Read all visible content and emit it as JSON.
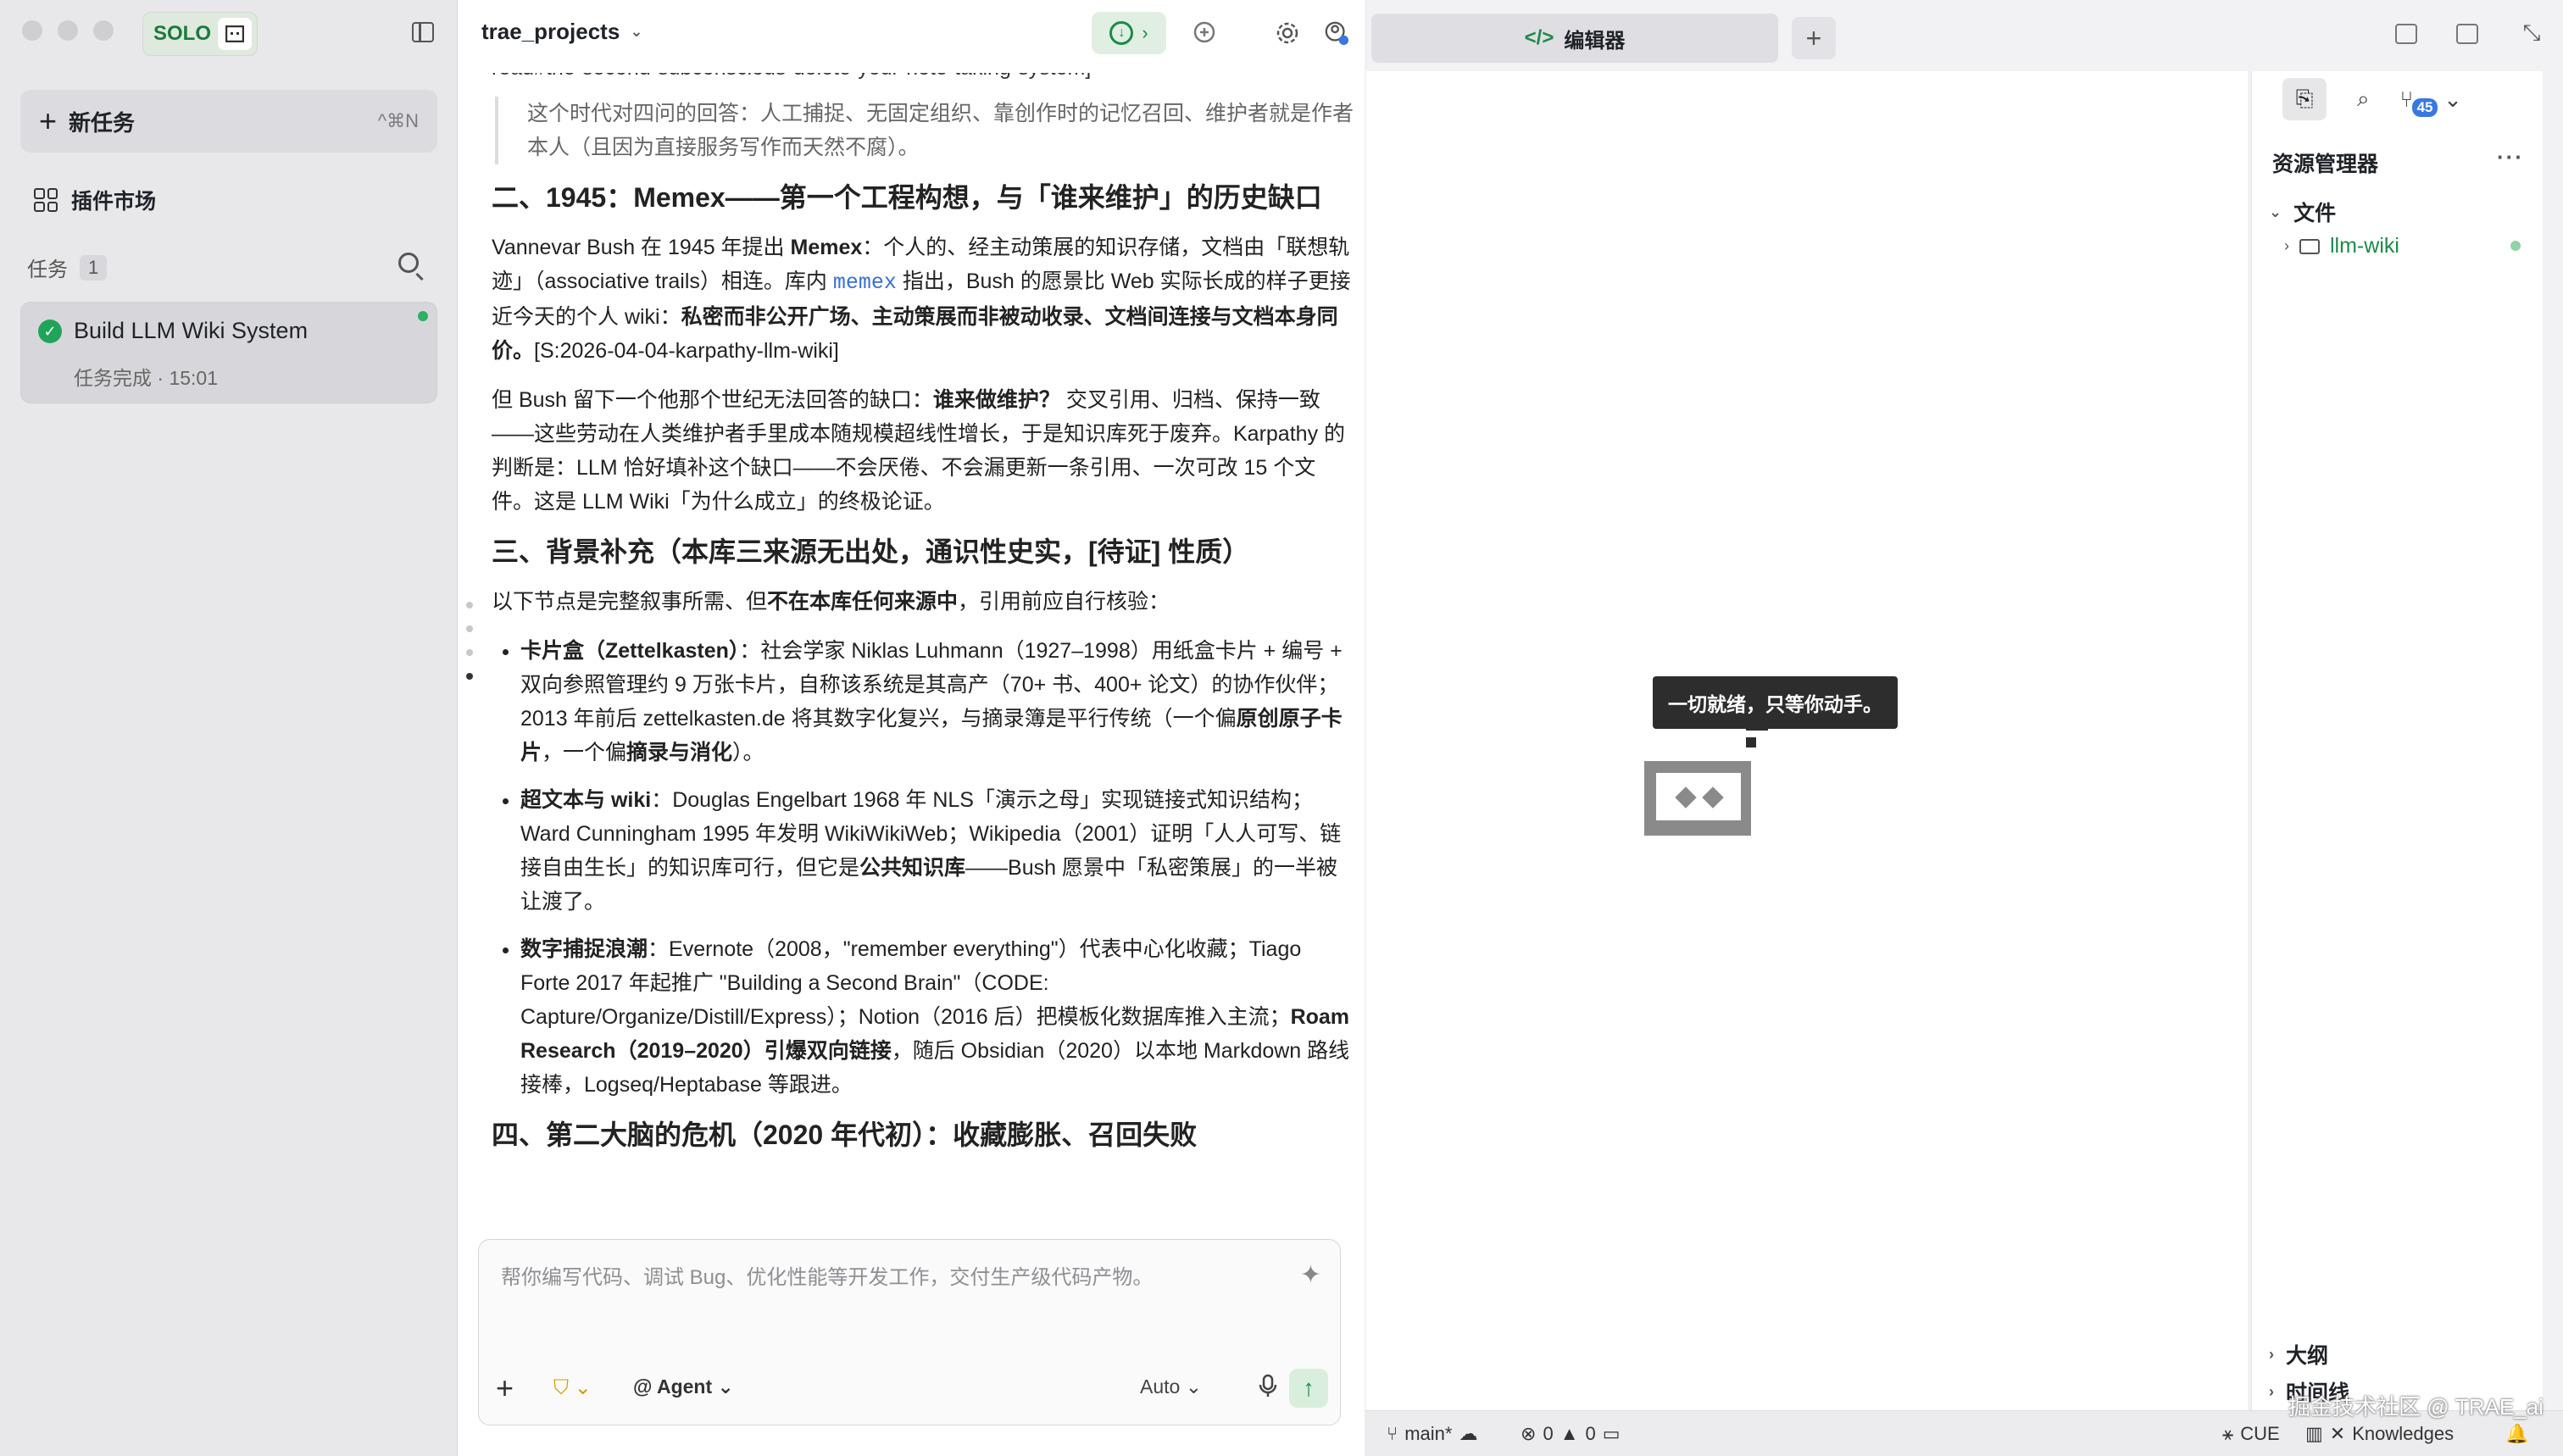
{
  "sidebar": {
    "brand": "SOLO",
    "new_task": {
      "label": "新任务",
      "shortcut": "^⌘N"
    },
    "plugins_label": "插件市场",
    "tasks_label": "任务",
    "tasks_count": "1",
    "task": {
      "title": "Build LLM Wiki System",
      "subtitle": "任务完成 · 15:01"
    }
  },
  "chat": {
    "project": "trae_projects",
    "cut_line": "read#the-second-subconscious-delete-your-note-taking-system]",
    "quote": "这个时代对四问的回答：人工捕捉、无固定组织、靠创作时的记忆召回、维护者就是作者本人（且因为直接服务写作而天然不腐）。",
    "h2_1": "二、1945：Memex——第一个工程构想，与「谁来维护」的历史缺口",
    "p1_a": "Vannevar Bush 在 1945 年提出 ",
    "p1_b": "Memex",
    "p1_c": "：个人的、经主动策展的知识存储，文档由「联想轨迹」（associative trails）相连。库内 ",
    "p1_code": "memex",
    "p1_d": " 指出，Bush 的愿景比 Web 实际长成的样子更接近今天的个人 wiki：",
    "p1_e": "私密而非公开广场、主动策展而非被动收录、文档间连接与文档本身同价。",
    "p1_f": "[S:2026-04-04-karpathy-llm-wiki]",
    "p2_a": "但 Bush 留下一个他那个世纪无法回答的缺口：",
    "p2_b": "谁来做维护？",
    "p2_c": " 交叉引用、归档、保持一致——这些劳动在人类维护者手里成本随规模超线性增长，于是知识库死于废弃。Karpathy 的判断是：LLM 恰好填补这个缺口——不会厌倦、不会漏更新一条引用、一次可改 15 个文件。这是 LLM Wiki「为什么成立」的终极论证。",
    "h2_2": "三、背景补充（本库三来源无出处，通识性史实，[待证] 性质）",
    "p3_a": "以下节点是完整叙事所需、但",
    "p3_b": "不在本库任何来源中",
    "p3_c": "，引用前应自行核验：",
    "li1_a": "卡片盒（Zettelkasten）",
    "li1_b": "：社会学家 Niklas Luhmann（1927–1998）用纸盒卡片 + 编号 + 双向参照管理约 9 万张卡片，自称该系统是其高产（70+ 书、400+ 论文）的协作伙伴；2013 年前后 zettelkasten.de 将其数字化复兴，与摘录簿是平行传统（一个偏",
    "li1_c": "原创原子卡片",
    "li1_d": "，一个偏",
    "li1_e": "摘录与消化",
    "li1_f": "）。",
    "li2_a": "超文本与 wiki",
    "li2_b": "：Douglas Engelbart 1968 年 NLS「演示之母」实现链接式知识结构；Ward Cunningham 1995 年发明 WikiWikiWeb；Wikipedia（2001）证明「人人可写、链接自由生长」的知识库可行，但它是",
    "li2_c": "公共知识库",
    "li2_d": "——Bush 愿景中「私密策展」的一半被让渡了。",
    "li3_a": "数字捕捉浪潮",
    "li3_b": "：Evernote（2008，\"remember everything\"）代表中心化收藏；Tiago Forte 2017 年起推广 \"Building a Second Brain\"（CODE: Capture/Organize/Distill/Express）；Notion（2016 后）把模板化数据库推入主流；",
    "li3_c": "Roam Research（2019–2020）引爆双向链接",
    "li3_d": "，随后 Obsidian（2020）以本地 Markdown 路线接棒，Logseq/Heptabase 等跟进。",
    "h2_3": "四、第二大脑的危机（2020 年代初）：收藏膨胀、召回失败",
    "input_placeholder": "帮你编写代码、调试 Bug、优化性能等开发工作，交付生产级代码产物。",
    "agent_label": "@ Agent",
    "auto_label": "Auto"
  },
  "editor": {
    "tab_label": "编辑器",
    "tooltip": "一切就绪，只等你动手。"
  },
  "explorer": {
    "title": "资源管理器",
    "badge": "45",
    "files_label": "文件",
    "folder": "llm-wiki",
    "outline": "大纲",
    "timeline": "时间线"
  },
  "status": {
    "branch": "main*",
    "errors": "0",
    "warnings": "0",
    "lang": "CUE",
    "knowledges": "Knowledges"
  },
  "watermark": "掘金技术社区 @ TRAE_ai",
  "colors": {
    "accent": "#1c8a48",
    "link": "#3b6fd6",
    "badge": "#3a77e0"
  }
}
